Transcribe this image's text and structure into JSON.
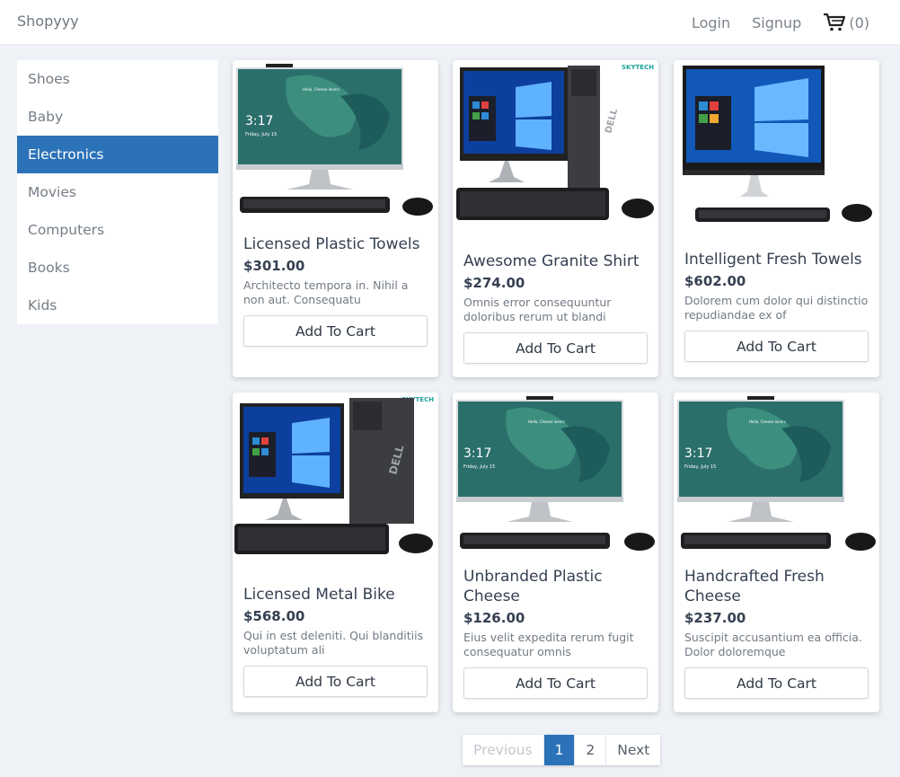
{
  "header": {
    "brand": "Shopyyy",
    "login": "Login",
    "signup": "Signup",
    "cart_count": "(0)"
  },
  "sidebar": {
    "items": [
      {
        "label": "Shoes"
      },
      {
        "label": "Baby"
      },
      {
        "label": "Electronics",
        "active": true
      },
      {
        "label": "Movies"
      },
      {
        "label": "Computers"
      },
      {
        "label": "Books"
      },
      {
        "label": "Kids"
      }
    ]
  },
  "products": [
    {
      "title": "Licensed Plastic Towels",
      "price": "$301.00",
      "description": "Architecto tempora in. Nihil a non aut. Consequatu",
      "button": "Add To Cart",
      "image": "all-in-one-desktop"
    },
    {
      "title": "Awesome Granite Shirt",
      "price": "$274.00",
      "description": "Omnis error consequuntur doloribus rerum ut blandi",
      "button": "Add To Cart",
      "image": "tower-desktop"
    },
    {
      "title": "Intelligent Fresh Towels",
      "price": "$602.00",
      "description": "Dolorem cum dolor qui distinctio repudiandae ex of",
      "button": "Add To Cart",
      "image": "windows-all-in-one"
    },
    {
      "title": "Licensed Metal Bike",
      "price": "$568.00",
      "description": "Qui in est deleniti. Qui blanditiis voluptatum ali",
      "button": "Add To Cart",
      "image": "tower-desktop"
    },
    {
      "title": "Unbranded Plastic Cheese",
      "price": "$126.00",
      "description": "Eius velit expedita rerum fugit consequatur omnis",
      "button": "Add To Cart",
      "image": "all-in-one-desktop"
    },
    {
      "title": "Handcrafted Fresh Cheese",
      "price": "$237.00",
      "description": "Suscipit accusantium ea officia. Dolor doloremque",
      "button": "Add To Cart",
      "image": "all-in-one-desktop"
    }
  ],
  "pagination": {
    "previous": "Previous",
    "pages": [
      "1",
      "2"
    ],
    "current": "1",
    "next": "Next"
  },
  "image_text": {
    "time": "3:17",
    "date": "Friday, July 15",
    "greeting": "Hello, Cheese lovers",
    "tower_brand": "SKYTECH",
    "case_brand": "DELL"
  },
  "colors": {
    "accent": "#2c72b8",
    "background": "#eef1f6"
  }
}
